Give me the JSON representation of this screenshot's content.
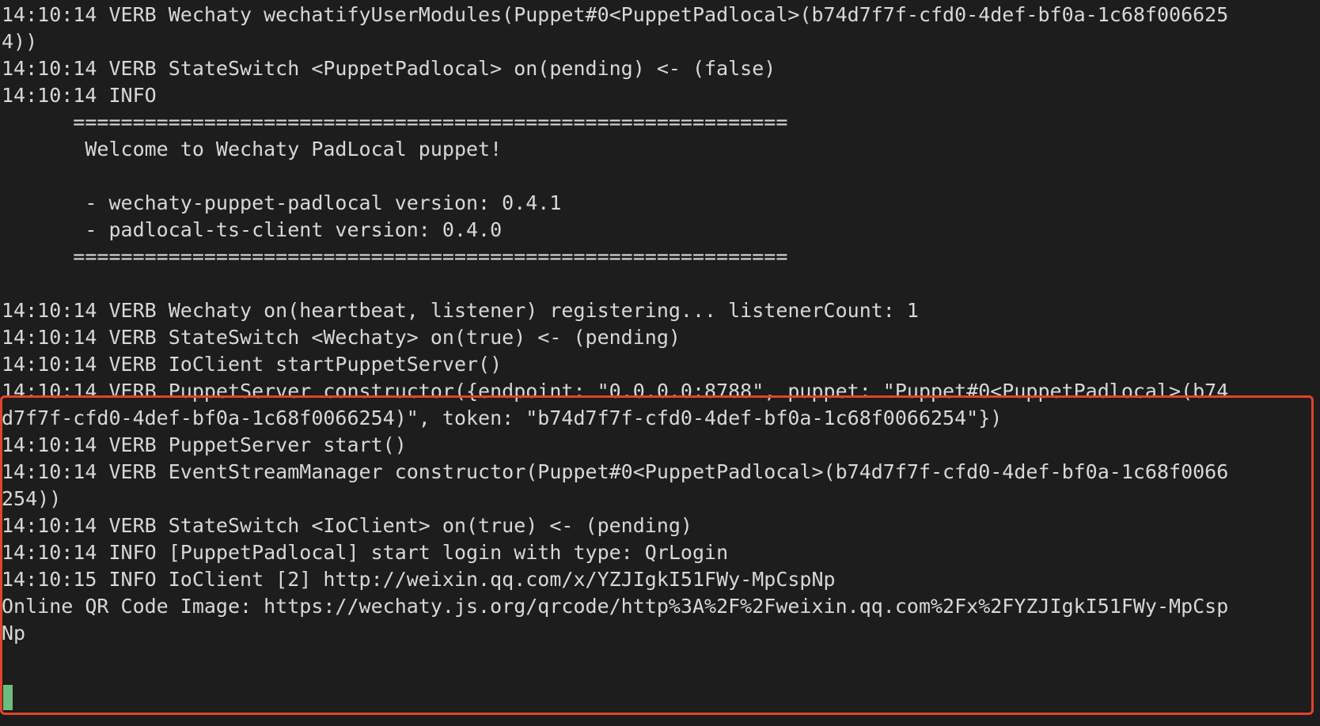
{
  "terminal": {
    "lines": [
      "14:10:14 VERB Wechaty wechatifyUserModules(Puppet#0<PuppetPadlocal>(b74d7f7f-cfd0-4def-bf0a-1c68f006625",
      "4))",
      "14:10:14 VERB StateSwitch <PuppetPadlocal> on(pending) <- (false)",
      "14:10:14 INFO",
      "      ============================================================",
      "       Welcome to Wechaty PadLocal puppet!",
      "",
      "       - wechaty-puppet-padlocal version: 0.4.1",
      "       - padlocal-ts-client version: 0.4.0",
      "      ============================================================",
      "",
      "14:10:14 VERB Wechaty on(heartbeat, listener) registering... listenerCount: 1",
      "14:10:14 VERB StateSwitch <Wechaty> on(true) <- (pending)",
      "14:10:14 VERB IoClient startPuppetServer()",
      "14:10:14 VERB PuppetServer constructor({endpoint: \"0.0.0.0:8788\", puppet: \"Puppet#0<PuppetPadlocal>(b74",
      "d7f7f-cfd0-4def-bf0a-1c68f0066254)\", token: \"b74d7f7f-cfd0-4def-bf0a-1c68f0066254\"})",
      "14:10:14 VERB PuppetServer start()",
      "14:10:14 VERB EventStreamManager constructor(Puppet#0<PuppetPadlocal>(b74d7f7f-cfd0-4def-bf0a-1c68f0066",
      "254))",
      "14:10:14 VERB StateSwitch <IoClient> on(true) <- (pending)",
      "14:10:14 INFO [PuppetPadlocal] start login with type: QrLogin",
      "14:10:15 INFO IoClient [2] http://weixin.qq.com/x/YZJIgkI51FWy-MpCspNp",
      "Online QR Code Image: https://wechaty.js.org/qrcode/http%3A%2F%2Fweixin.qq.com%2Fx%2FYZJIgkI51FWy-MpCsp",
      "Np"
    ]
  },
  "colors": {
    "background": "#1d1d1d",
    "text": "#d8d8d8",
    "highlight_border": "#e2432a",
    "cursor": "#6dbd7c"
  }
}
